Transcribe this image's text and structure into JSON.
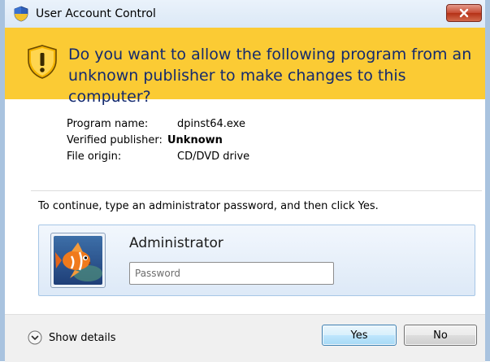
{
  "window": {
    "title": "User Account Control",
    "close_icon": "close-icon"
  },
  "banner": {
    "icon": "warning-shield-icon",
    "message": "Do you want to allow the following program from an unknown publisher to make changes to this computer?",
    "color": "#fbcb34",
    "text_color": "#142a6e"
  },
  "program_info": {
    "program_name_label": "Program name:",
    "program_name_value": "dpinst64.exe",
    "publisher_label": "Verified publisher:",
    "publisher_value": "Unknown",
    "origin_label": "File origin:",
    "origin_value": "CD/DVD drive"
  },
  "instruction": "To continue, type an administrator password, and then click Yes.",
  "account": {
    "name": "Administrator",
    "avatar_icon": "fish-avatar-icon",
    "password_placeholder": "Password",
    "password_value": ""
  },
  "footer": {
    "details_label": "Show details",
    "details_icon": "chevron-down-circle-icon",
    "yes_label": "Yes",
    "no_label": "No"
  }
}
